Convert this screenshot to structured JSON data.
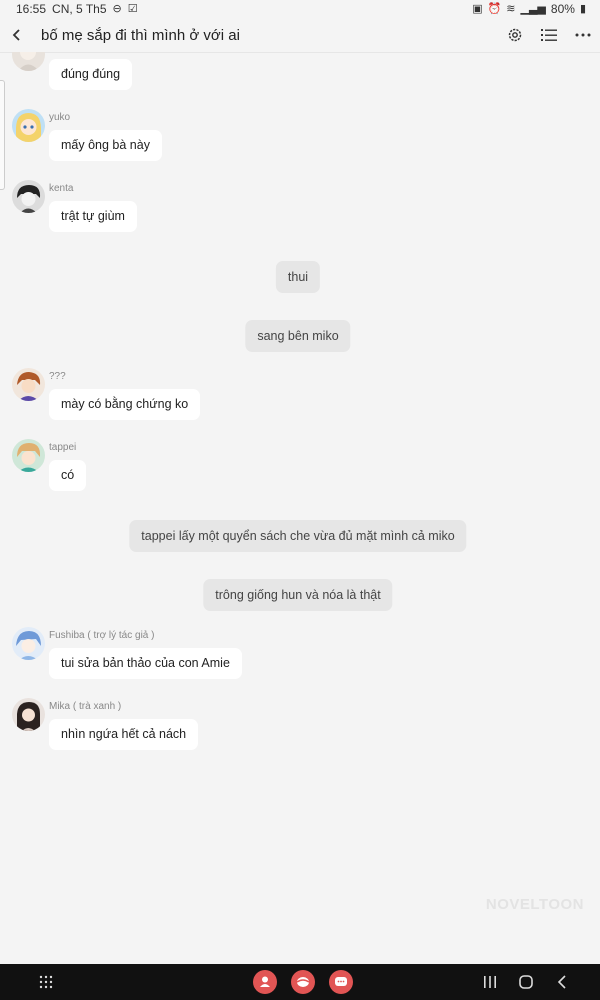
{
  "status_bar": {
    "time": "16:55",
    "date": "CN, 5 Th5",
    "battery": "80%"
  },
  "header": {
    "title": "bố mẹ sắp đi thì mình ở với ai"
  },
  "messages": {
    "m0": {
      "text": "đúng đúng"
    },
    "m1": {
      "name": "yuko",
      "text": "mấy ông bà này"
    },
    "m2": {
      "name": "kenta",
      "text": "trật tự giùm"
    },
    "n1": {
      "text": "thui"
    },
    "n2": {
      "text": "sang bên miko"
    },
    "m3": {
      "name": "???",
      "text": "mày có bằng chứng ko"
    },
    "m4": {
      "name": "tappei",
      "text": "có"
    },
    "n3": {
      "text": "tappei lấy một quyển sách che vừa đủ mặt mình cả miko"
    },
    "n4": {
      "text": "trông giống hun và nóa là thật"
    },
    "m5": {
      "name": "Fushiba ( trợ lý tác giả )",
      "text": "tui sửa bản thảo của con Amie"
    },
    "m6": {
      "name": "Mika ( trà xanh )",
      "text": "nhìn ngứa hết cả nách"
    }
  },
  "watermark": "NOVELTOON",
  "icons": {
    "back": "chevron-left-icon",
    "settings": "gear-icon",
    "list": "list-icon",
    "more": "more-icon",
    "nav_apps": "grid-icon",
    "nav_recent": "recent-apps-icon",
    "nav_home": "home-icon",
    "nav_back": "back-icon"
  },
  "colors": {
    "background": "#f4f4f4",
    "bubble": "#ffffff",
    "narration": "#e6e6e6",
    "app_red": "#e15554",
    "navbar": "#111111"
  }
}
